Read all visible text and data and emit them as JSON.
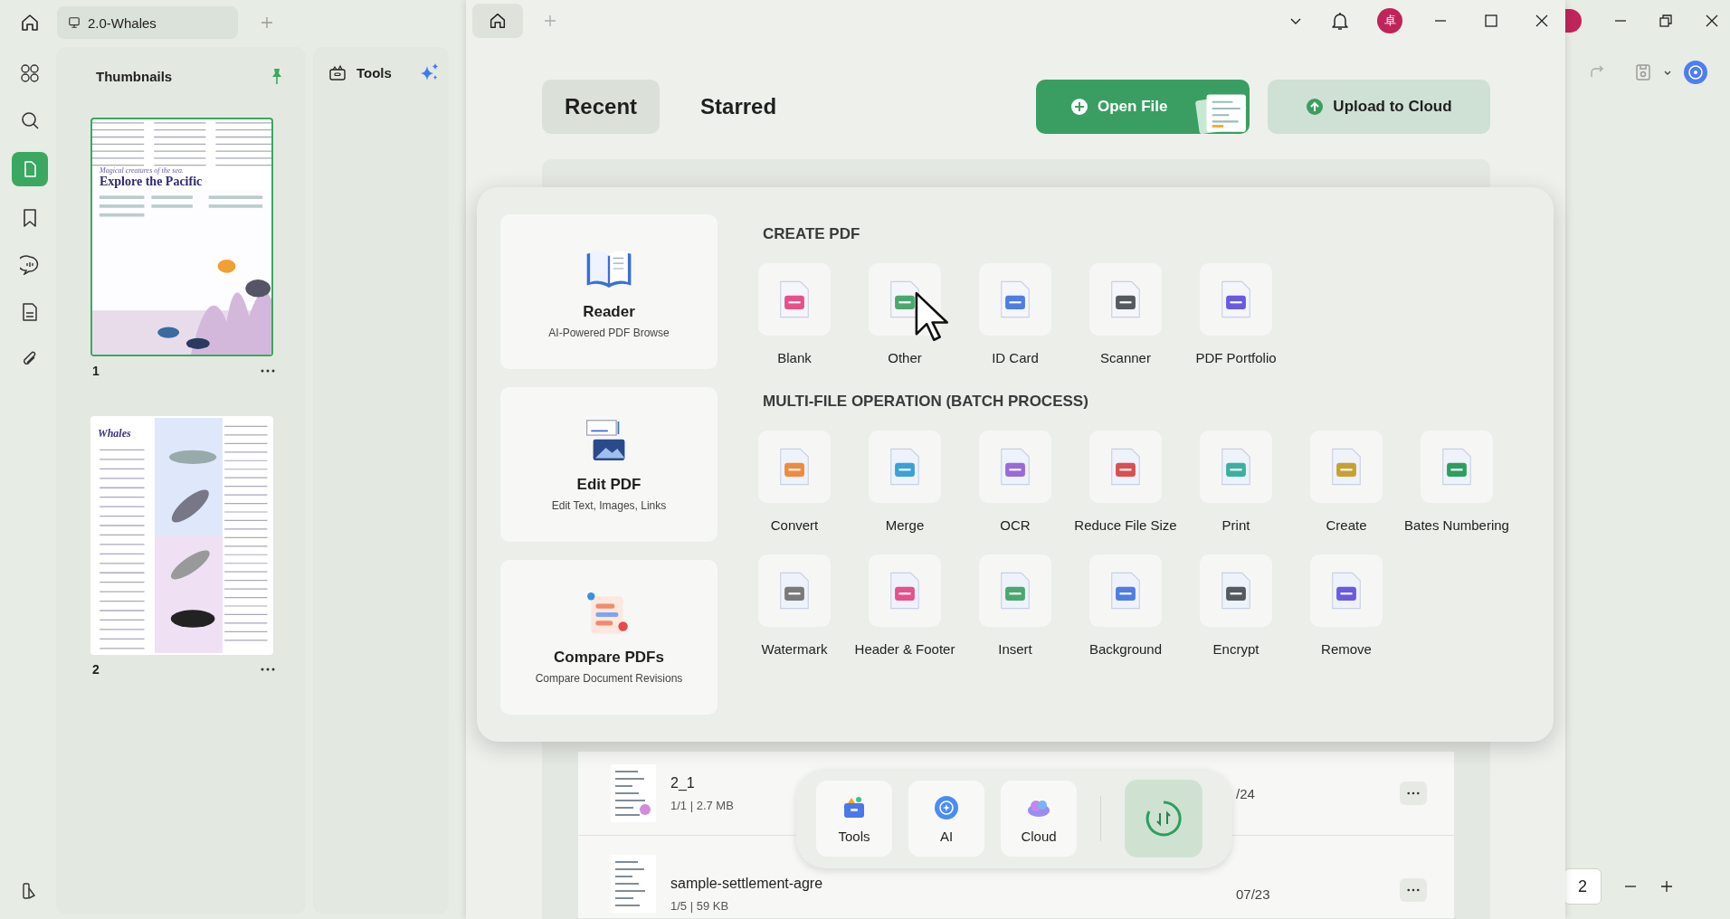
{
  "back_window": {
    "tab_title": "2.0-Whales",
    "panel_title": "Thumbnails",
    "tools_label": "Tools",
    "pages": [
      {
        "number": "1",
        "selected": true,
        "subheading": "Magical creatures of the sea.",
        "heading": "Explore the Pacific"
      },
      {
        "number": "2",
        "selected": false,
        "heading": "Whales"
      }
    ],
    "page_field": "2"
  },
  "front_window": {
    "tabs": [
      {
        "label": "Recent",
        "selected": true
      },
      {
        "label": "Starred",
        "selected": false
      }
    ],
    "open_file": "Open File",
    "upload": "Upload to Cloud",
    "avatar": "卓",
    "files": [
      {
        "name": "2_1",
        "meta": "1/1 | 2.7 MB",
        "date": "/24"
      },
      {
        "name": "sample-settlement-agre",
        "meta": "1/5 | 59 KB",
        "date": "07/23"
      }
    ]
  },
  "tool_panel": {
    "cards": [
      {
        "title": "Reader",
        "subtitle": "AI-Powered PDF Browse"
      },
      {
        "title": "Edit PDF",
        "subtitle": "Edit Text, Images, Links"
      },
      {
        "title": "Compare PDFs",
        "subtitle": "Compare Document Revisions"
      }
    ],
    "sections": [
      {
        "title": "CREATE PDF",
        "tools": [
          {
            "label": "Blank"
          },
          {
            "label": "Other"
          },
          {
            "label": "ID Card"
          },
          {
            "label": "Scanner"
          },
          {
            "label": "PDF Portfolio"
          }
        ]
      },
      {
        "title": "MULTI-FILE OPERATION (BATCH PROCESS)",
        "tools": [
          {
            "label": "Convert"
          },
          {
            "label": "Merge"
          },
          {
            "label": "OCR"
          },
          {
            "label": "Reduce File Size"
          },
          {
            "label": "Print"
          },
          {
            "label": "Create"
          },
          {
            "label": "Bates Numbering"
          },
          {
            "label": "Watermark"
          },
          {
            "label": "Header & Footer"
          },
          {
            "label": "Insert"
          },
          {
            "label": "Background"
          },
          {
            "label": "Encrypt"
          },
          {
            "label": "Remove"
          }
        ]
      }
    ]
  },
  "dock": {
    "items": [
      {
        "label": "Tools"
      },
      {
        "label": "AI"
      },
      {
        "label": "Cloud"
      }
    ]
  }
}
